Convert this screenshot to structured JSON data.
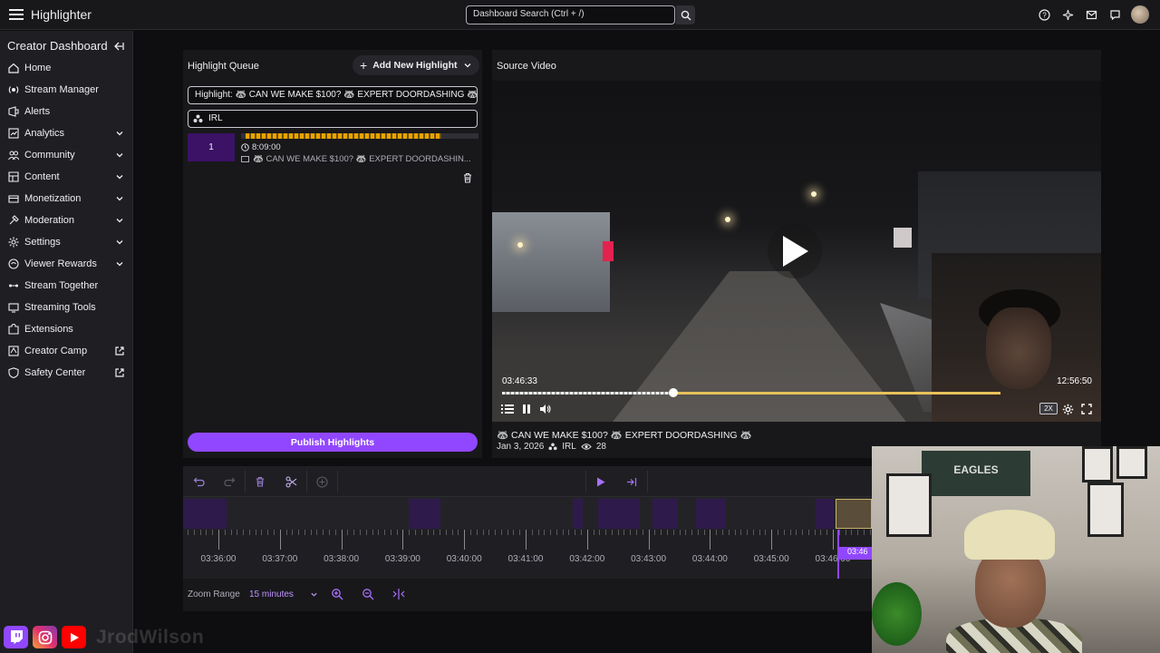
{
  "app": {
    "title": "Highlighter"
  },
  "search": {
    "placeholder": "Dashboard Search (Ctrl + /)"
  },
  "sidebar": {
    "title": "Creator Dashboard",
    "items": [
      {
        "label": "Home",
        "icon": "home-icon"
      },
      {
        "label": "Stream Manager",
        "icon": "stream-manager-icon"
      },
      {
        "label": "Alerts",
        "icon": "alerts-icon"
      },
      {
        "label": "Analytics",
        "icon": "analytics-icon",
        "expandable": true
      },
      {
        "label": "Community",
        "icon": "community-icon",
        "expandable": true
      },
      {
        "label": "Content",
        "icon": "content-icon",
        "expandable": true
      },
      {
        "label": "Monetization",
        "icon": "monetization-icon",
        "expandable": true
      },
      {
        "label": "Moderation",
        "icon": "moderation-icon",
        "expandable": true
      },
      {
        "label": "Settings",
        "icon": "settings-icon",
        "expandable": true
      },
      {
        "label": "Viewer Rewards",
        "icon": "viewer-rewards-icon",
        "expandable": true
      },
      {
        "label": "Stream Together",
        "icon": "stream-together-icon"
      },
      {
        "label": "Streaming Tools",
        "icon": "streaming-tools-icon"
      },
      {
        "label": "Extensions",
        "icon": "extensions-icon"
      },
      {
        "label": "Creator Camp",
        "icon": "creator-camp-icon",
        "external": true
      },
      {
        "label": "Safety Center",
        "icon": "safety-center-icon",
        "external": true
      }
    ]
  },
  "queue": {
    "title": "Highlight Queue",
    "add_label": "Add New Highlight",
    "title_field": "Highlight: 🦝 CAN WE MAKE $100? 🦝 EXPERT DOORDASHING 🦝",
    "category_field": "IRL",
    "clip": {
      "index": "1",
      "duration": "8:09:00",
      "title": "🦝 CAN WE MAKE $100? 🦝 EXPERT DOORDASHIN..."
    },
    "publish_label": "Publish Highlights"
  },
  "video": {
    "panel_title": "Source Video",
    "current_time": "03:46:33",
    "total_time": "12:56:50",
    "speed": "2X",
    "progress": 0.34,
    "title": "🦝 CAN WE MAKE $100? 🦝 EXPERT DOORDASHING 🦝",
    "date": "Jan 3, 2026",
    "category": "IRL",
    "views": "28"
  },
  "timeline": {
    "labels": [
      "03:36:00",
      "03:37:00",
      "03:38:00",
      "03:39:00",
      "03:40:00",
      "03:41:00",
      "03:42:00",
      "03:43:00",
      "03:44:00",
      "03:45:00",
      "03:46:00"
    ],
    "playhead_label": "03:46",
    "zoom_label": "Zoom Range",
    "zoom_value": "15 minutes"
  },
  "webcam": {
    "banner": "EAGLES"
  },
  "social": {
    "handle": "JrodWilson"
  },
  "colors": {
    "accent": "#9147ff",
    "highlight_gold": "#e8a400",
    "bg": "#0e0e10",
    "panel": "#18181b"
  }
}
